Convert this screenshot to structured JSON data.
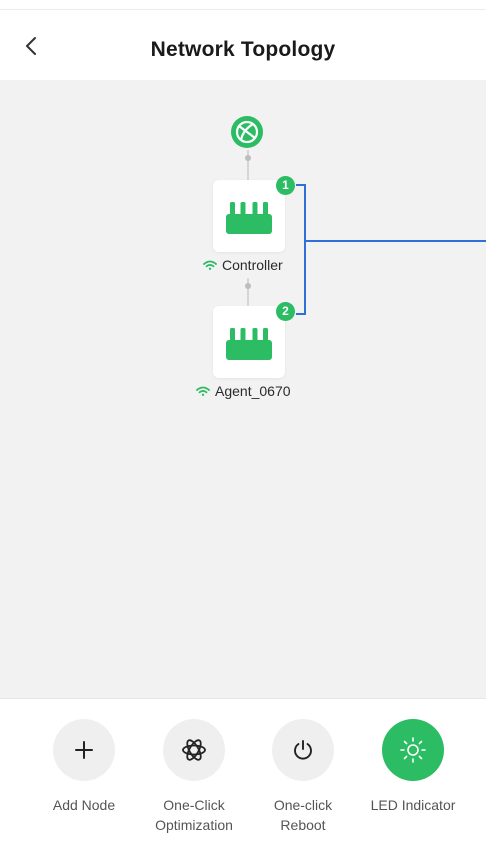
{
  "header": {
    "title": "Network Topology"
  },
  "topology": {
    "nodes": [
      {
        "badge": "1",
        "label": "Controller"
      },
      {
        "badge": "2",
        "label": "Agent_0670"
      }
    ]
  },
  "actions": [
    {
      "label_line1": "Add Node",
      "label_line2": ""
    },
    {
      "label_line1": "One-Click",
      "label_line2": "Optimization"
    },
    {
      "label_line1": "One-click",
      "label_line2": "Reboot"
    },
    {
      "label_line1": "LED Indicator",
      "label_line2": ""
    }
  ],
  "colors": {
    "accent": "#2cbc63",
    "link": "#2f6fd9",
    "canvas": "#f2f2f2"
  },
  "icons": {
    "back": "chevron-left-icon",
    "internet": "globe-icon",
    "router": "router-icon",
    "wifi": "wifi-icon",
    "add": "plus-icon",
    "optimize": "atom-icon",
    "reboot": "power-icon",
    "led": "sun-icon"
  }
}
